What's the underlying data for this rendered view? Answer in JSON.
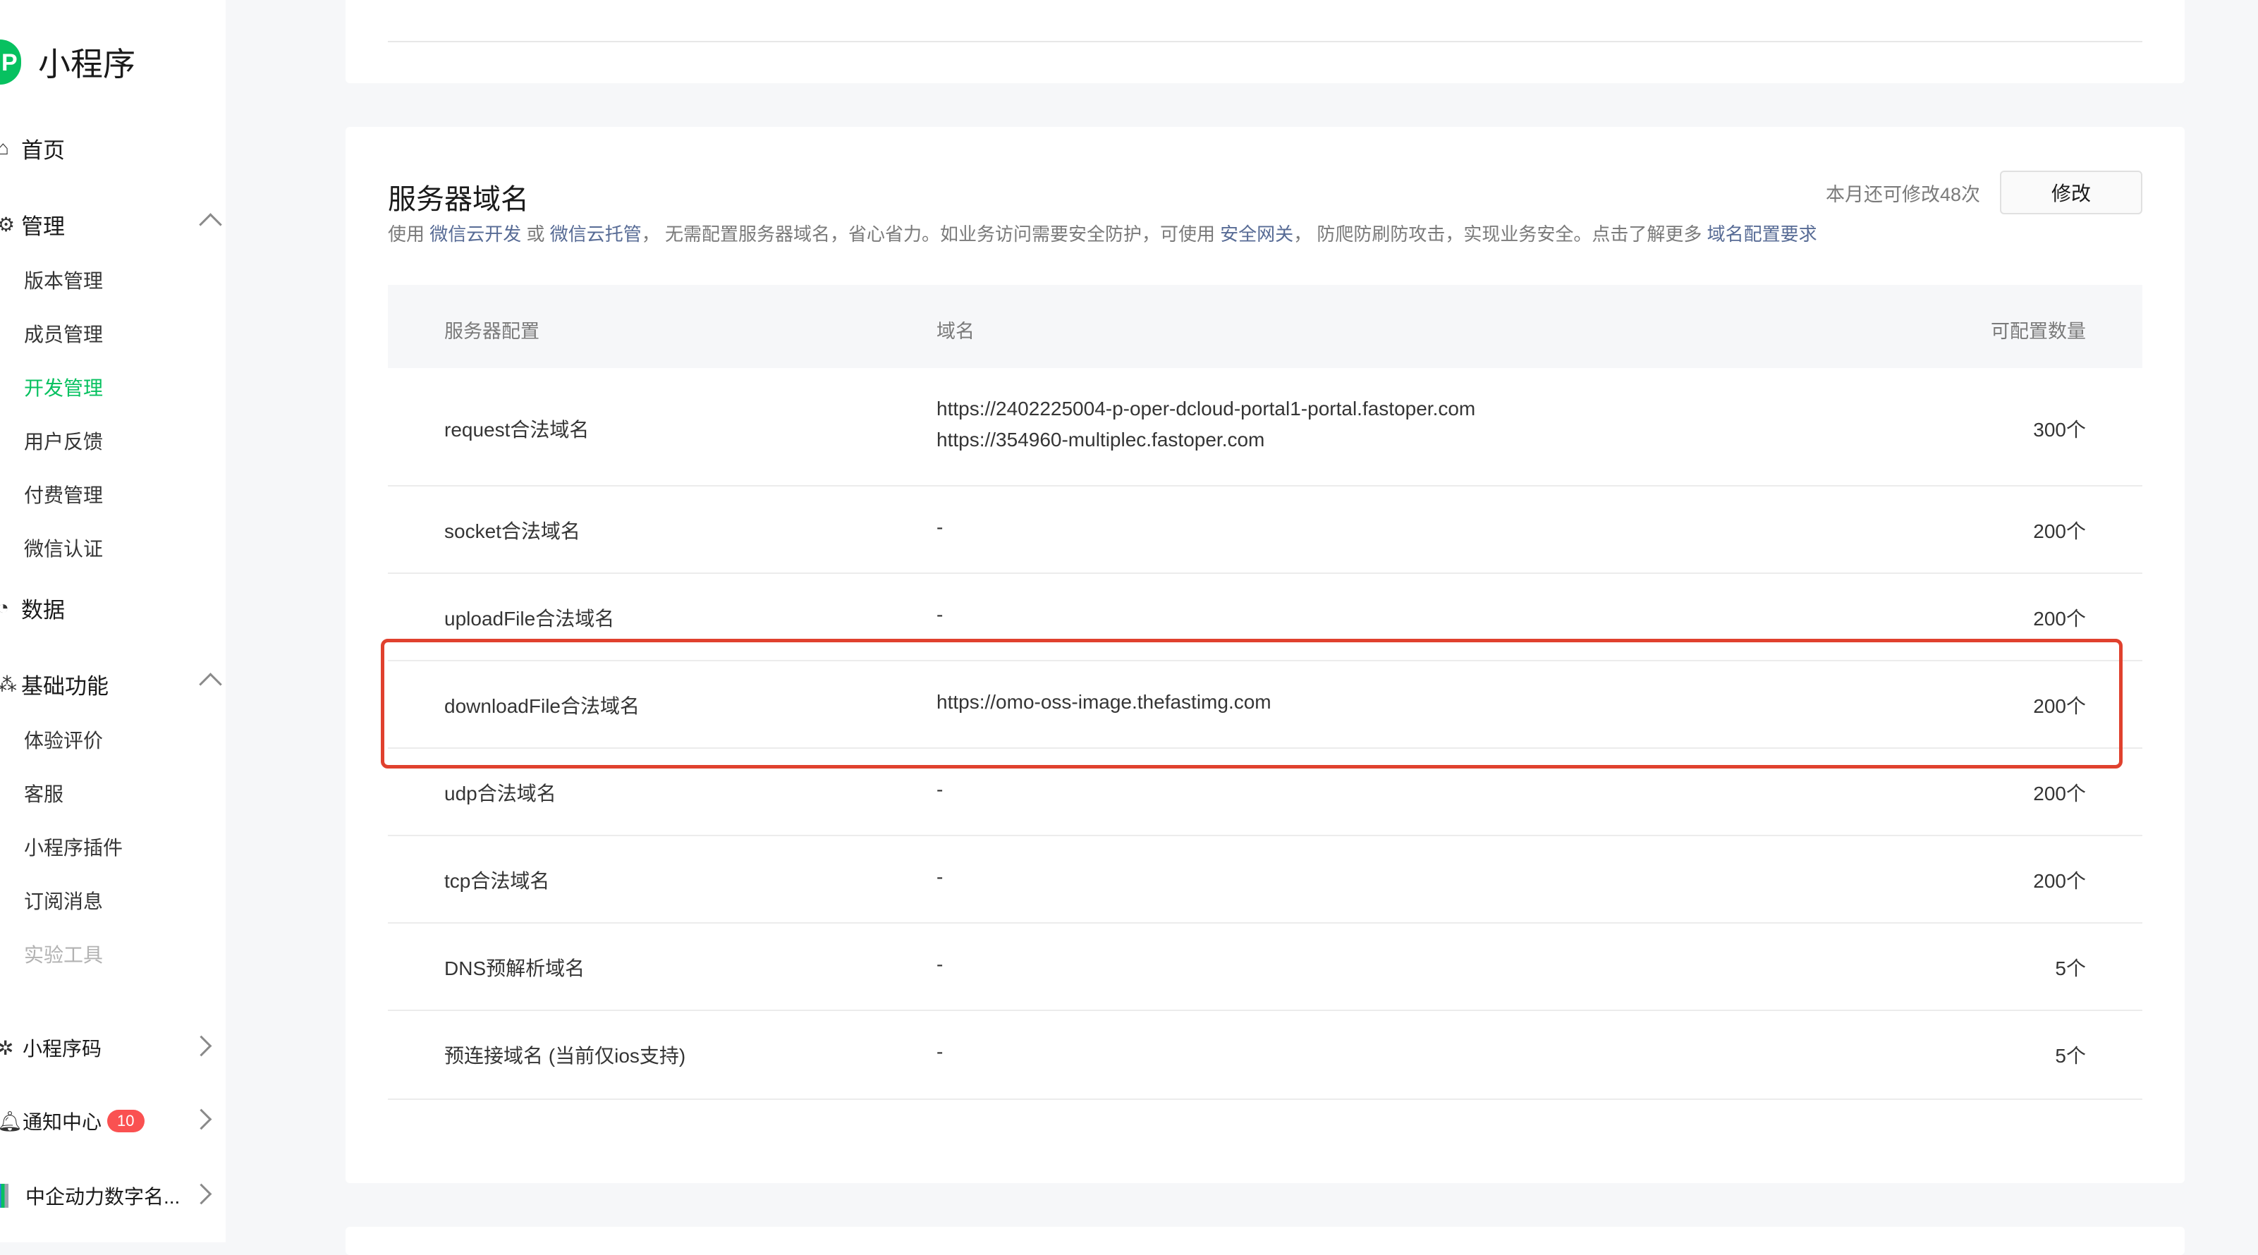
{
  "sidebar": {
    "logo_text": "小程序",
    "logo_mark": "P",
    "home": "首页",
    "manage": "管理",
    "manage_items": [
      "版本管理",
      "成员管理",
      "开发管理",
      "用户反馈",
      "付费管理",
      "微信认证"
    ],
    "data": "数据",
    "basic": "基础功能",
    "basic_items": [
      "体验评价",
      "客服",
      "小程序插件",
      "订阅消息",
      "实验工具"
    ],
    "qrcode": "小程序码",
    "notify": "通知中心",
    "notify_count": "10",
    "account": "中企动力数字名..."
  },
  "section": {
    "title": "服务器域名",
    "quota_text": "本月还可修改48次",
    "modify_label": "修改",
    "desc": {
      "p1": "使用 ",
      "l1": "微信云开发",
      "p2": " 或 ",
      "l2": "微信云托管",
      "p3": "， 无需配置服务器域名，省心省力。如业务访问需要安全防护，可使用 ",
      "l3": "安全网关",
      "p4": "， 防爬防刷防攻击，实现业务安全。点击了解更多 ",
      "l4": "域名配置要求"
    }
  },
  "table": {
    "headers": [
      "服务器配置",
      "域名",
      "可配置数量"
    ],
    "rows": [
      {
        "name": "request合法域名",
        "domains": [
          "https://2402225004-p-oper-dcloud-portal1-portal.fastoper.com",
          "https://354960-multiplec.fastoper.com"
        ],
        "count": "300个"
      },
      {
        "name": "socket合法域名",
        "domains": [
          "-"
        ],
        "count": "200个"
      },
      {
        "name": "uploadFile合法域名",
        "domains": [
          "-"
        ],
        "count": "200个"
      },
      {
        "name": "downloadFile合法域名",
        "domains": [
          "https://omo-oss-image.thefastimg.com"
        ],
        "count": "200个"
      },
      {
        "name": "udp合法域名",
        "domains": [
          "-"
        ],
        "count": "200个"
      },
      {
        "name": "tcp合法域名",
        "domains": [
          "-"
        ],
        "count": "200个"
      },
      {
        "name": "DNS预解析域名",
        "domains": [
          "-"
        ],
        "count": "5个"
      },
      {
        "name": "预连接域名 (当前仅ios支持)",
        "domains": [
          "-"
        ],
        "count": "5个"
      }
    ]
  },
  "colors": {
    "accent": "#07c160",
    "link": "#576b95",
    "highlight": "#e0412e",
    "badge": "#fa5151"
  }
}
